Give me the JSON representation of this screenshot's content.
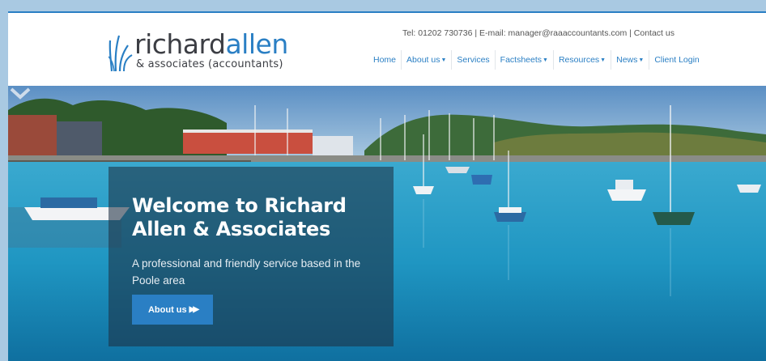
{
  "logo": {
    "name_part1": "richard",
    "name_part2": "allen",
    "tagline": "& associates (accountants)"
  },
  "contact": {
    "line": "Tel: 01202 730736 | E-mail: manager@raaaccountants.com | Contact us"
  },
  "nav": {
    "items": [
      {
        "label": "Home",
        "has_dropdown": false
      },
      {
        "label": "About us",
        "has_dropdown": true
      },
      {
        "label": "Services",
        "has_dropdown": false
      },
      {
        "label": "Factsheets",
        "has_dropdown": true
      },
      {
        "label": "Resources",
        "has_dropdown": true
      },
      {
        "label": "News",
        "has_dropdown": true
      },
      {
        "label": "Client Login",
        "has_dropdown": false
      }
    ],
    "dropdown_icon": "caret-down-icon"
  },
  "hero": {
    "title": "Welcome to Richard Allen & Associates",
    "subtitle": "A professional and friendly service based in the Poole area",
    "button_label": "About us",
    "button_icon": "double-chevron-right-icon",
    "scroll_icon": "chevron-down-icon"
  },
  "colors": {
    "brand_blue": "#2a7fc4",
    "page_background": "#a9c9e2",
    "text_dark": "#3c3e44",
    "overlay": "rgba(30,48,68,0.58)"
  }
}
